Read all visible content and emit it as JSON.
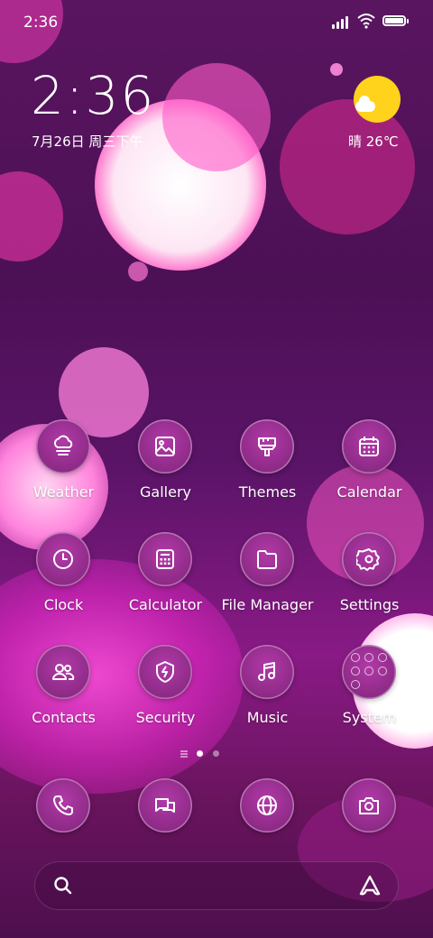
{
  "status_bar": {
    "time": "2:36"
  },
  "clock_widget": {
    "time": "2:36",
    "date": "7月26日 周三下午"
  },
  "weather_widget": {
    "condition": "晴",
    "temperature": "26℃",
    "text": "晴 26℃"
  },
  "apps": [
    {
      "label": "Weather",
      "icon": "weather-icon"
    },
    {
      "label": "Gallery",
      "icon": "gallery-icon"
    },
    {
      "label": "Themes",
      "icon": "themes-icon"
    },
    {
      "label": "Calendar",
      "icon": "calendar-icon"
    },
    {
      "label": "Clock",
      "icon": "clock-icon"
    },
    {
      "label": "Calculator",
      "icon": "calculator-icon"
    },
    {
      "label": "File Manager",
      "icon": "folder-icon"
    },
    {
      "label": "Settings",
      "icon": "gear-icon"
    },
    {
      "label": "Contacts",
      "icon": "contacts-icon"
    },
    {
      "label": "Security",
      "icon": "shield-icon"
    },
    {
      "label": "Music",
      "icon": "music-note-icon"
    },
    {
      "label": "System",
      "icon": "folder-grid-icon"
    }
  ],
  "dock": [
    {
      "name": "phone",
      "icon": "phone-icon"
    },
    {
      "name": "messages",
      "icon": "message-icon"
    },
    {
      "name": "browser",
      "icon": "globe-icon"
    },
    {
      "name": "camera",
      "icon": "camera-icon"
    }
  ],
  "page_indicator": {
    "current": 1,
    "total": 2
  },
  "colors": {
    "accent_icon": "#8d2a86",
    "sun": "#ffd21c"
  }
}
